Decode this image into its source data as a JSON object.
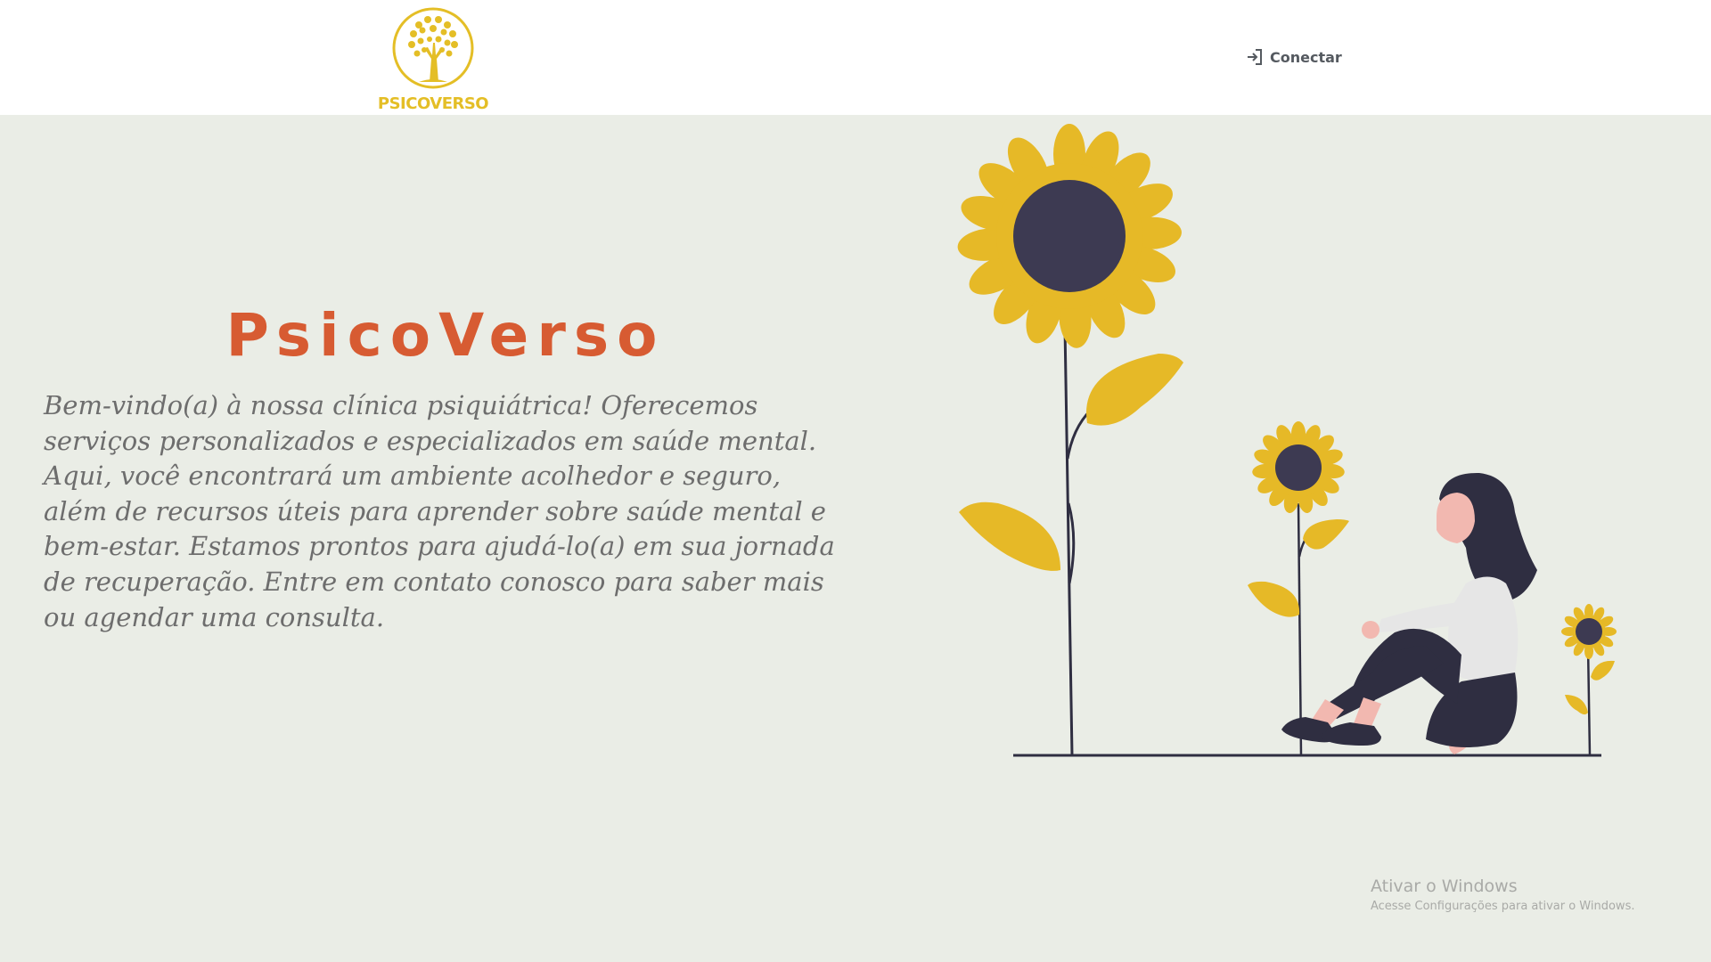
{
  "header": {
    "logo_text": "PSICOVERSO",
    "connect_label": "Conectar",
    "connect_icon": "login-icon"
  },
  "hero": {
    "title": "PsicoVerso",
    "description": "Bem-vindo(a) à nossa clínica psiquiátrica! Oferecemos serviços personalizados e especializados em saúde mental. Aqui, você encontrará um ambiente acolhedor e seguro, além de recursos úteis para aprender sobre saúde mental e bem-estar. Estamos prontos para ajudá-lo(a) em sua jornada de recuperação. Entre em contato conosco para saber mais ou agendar uma consulta."
  },
  "watermark": {
    "title": "Ativar o Windows",
    "subtitle": "Acesse Configurações para ativar o Windows."
  },
  "colors": {
    "background": "#eaede6",
    "header_bg": "#ffffff",
    "title": "#d75b32",
    "logo": "#e4be26",
    "sunflower_petal": "#e6b927",
    "sunflower_center": "#3d3a52",
    "dark": "#2f2e41",
    "skin": "#f2b8b0"
  }
}
